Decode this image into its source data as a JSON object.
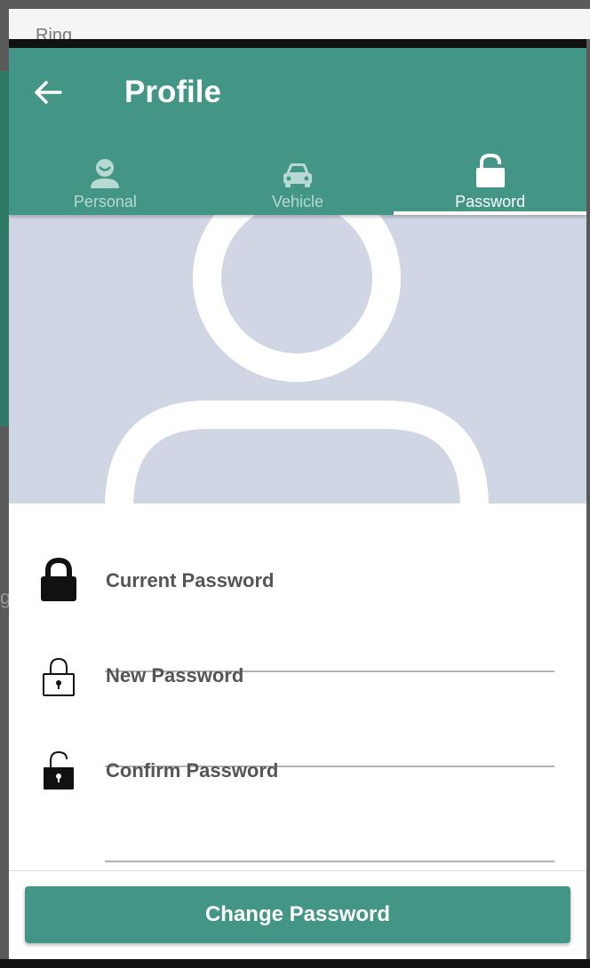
{
  "background": {
    "app_title": "Ring",
    "partial_letter": "g"
  },
  "header": {
    "title": "Profile",
    "back_icon": "arrow-left-icon",
    "color": "#439686"
  },
  "tabs": [
    {
      "label": "Personal",
      "icon": "person-face-icon",
      "active": false
    },
    {
      "label": "Vehicle",
      "icon": "car-icon",
      "active": false
    },
    {
      "label": "Password",
      "icon": "unlock-icon",
      "active": true
    }
  ],
  "avatar": {
    "icon": "user-avatar-icon",
    "background": "#d0d6e4"
  },
  "form": {
    "current_password": {
      "label": "Current Password",
      "value": "",
      "icon": "lock-filled-icon"
    },
    "new_password": {
      "label": "New Password",
      "value": "",
      "icon": "lock-outline-icon"
    },
    "confirm_password": {
      "label": "Confirm Password",
      "value": "",
      "icon": "unlock-filled-icon"
    }
  },
  "actions": {
    "change_password_label": "Change Password"
  }
}
